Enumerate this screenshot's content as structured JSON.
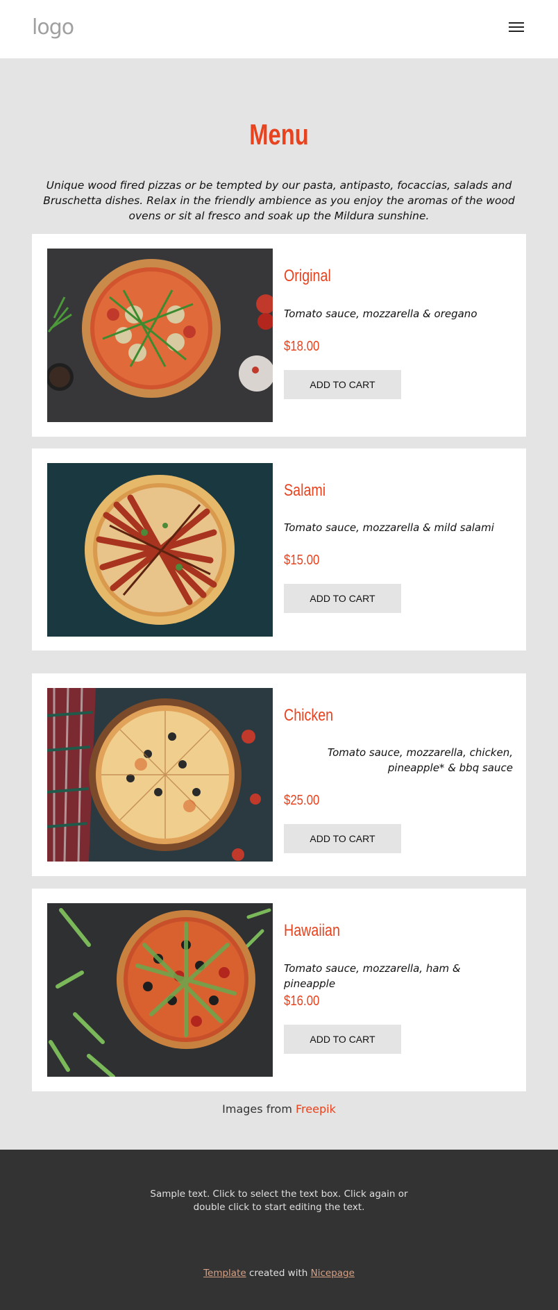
{
  "header": {
    "logo_text": "logo",
    "menu_icon": "hamburger-menu-icon"
  },
  "hero": {
    "title": "Menu",
    "intro": "Unique wood fired pizzas or be tempted by our pasta, antipasto, focaccias, salads and Bruschetta dishes. Relax in the friendly ambience as you enjoy the aromas of the wood ovens or sit al fresco and soak up the Mildura sunshine."
  },
  "items": [
    {
      "name": "Original",
      "description": "Tomato sauce, mozzarella & oregano",
      "price": "$18.00",
      "button": "ADD TO CART"
    },
    {
      "name": "Salami",
      "description": "Tomato sauce, mozzarella & mild salami",
      "price": "$15.00",
      "button": "ADD TO CART"
    },
    {
      "name": "Chicken",
      "description": "Tomato sauce, mozzarella, chicken, pineapple* & bbq sauce",
      "price": "$25.00",
      "button": "ADD TO CART"
    },
    {
      "name": "Hawaiian",
      "description": "Tomato sauce, mozzarella, ham & pineapple",
      "price": "$16.00",
      "button": "ADD TO CART"
    }
  ],
  "credit": {
    "prefix": "Images from",
    "link": "Freepik"
  },
  "footer": {
    "sample_text": "Sample text. Click to select the text box. Click again or double click to start editing the text.",
    "template_link": "Template",
    "created_with": "created with",
    "nicepage_link": "Nicepage"
  },
  "colors": {
    "accent": "#e8431f",
    "page_bg": "#e4e4e4",
    "footer_bg": "#333333",
    "button_bg": "#e4e4e4"
  }
}
